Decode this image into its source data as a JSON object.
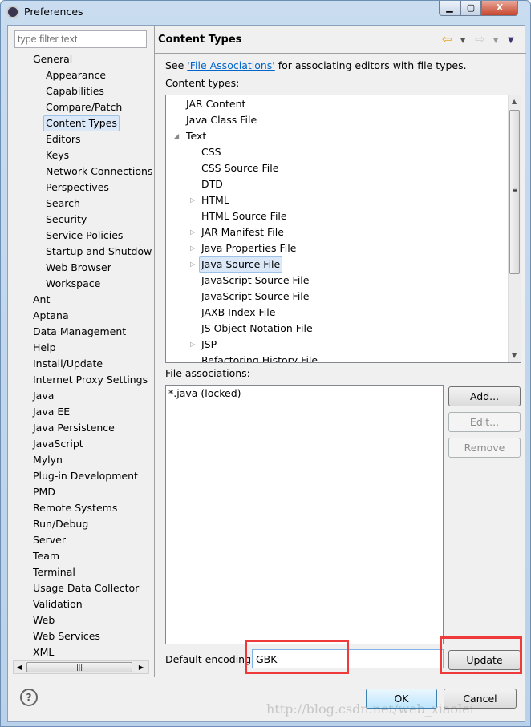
{
  "window": {
    "title": "Preferences",
    "minimize": "▁",
    "maximize": "▢",
    "close": "X"
  },
  "sidebar": {
    "filter_placeholder": "type filter text",
    "items": [
      {
        "label": "General",
        "level": 0
      },
      {
        "label": "Appearance",
        "level": 1
      },
      {
        "label": "Capabilities",
        "level": 1
      },
      {
        "label": "Compare/Patch",
        "level": 1
      },
      {
        "label": "Content Types",
        "level": 1,
        "selected": true
      },
      {
        "label": "Editors",
        "level": 1
      },
      {
        "label": "Keys",
        "level": 1
      },
      {
        "label": "Network Connections",
        "level": 1
      },
      {
        "label": "Perspectives",
        "level": 1
      },
      {
        "label": "Search",
        "level": 1
      },
      {
        "label": "Security",
        "level": 1
      },
      {
        "label": "Service Policies",
        "level": 1
      },
      {
        "label": "Startup and Shutdow",
        "level": 1
      },
      {
        "label": "Web Browser",
        "level": 1
      },
      {
        "label": "Workspace",
        "level": 1
      },
      {
        "label": "Ant",
        "level": 0
      },
      {
        "label": "Aptana",
        "level": 0
      },
      {
        "label": "Data Management",
        "level": 0
      },
      {
        "label": "Help",
        "level": 0
      },
      {
        "label": "Install/Update",
        "level": 0
      },
      {
        "label": "Internet Proxy Settings",
        "level": 0
      },
      {
        "label": "Java",
        "level": 0
      },
      {
        "label": "Java EE",
        "level": 0
      },
      {
        "label": "Java Persistence",
        "level": 0
      },
      {
        "label": "JavaScript",
        "level": 0
      },
      {
        "label": "Mylyn",
        "level": 0
      },
      {
        "label": "Plug-in Development",
        "level": 0
      },
      {
        "label": "PMD",
        "level": 0
      },
      {
        "label": "Remote Systems",
        "level": 0
      },
      {
        "label": "Run/Debug",
        "level": 0
      },
      {
        "label": "Server",
        "level": 0
      },
      {
        "label": "Team",
        "level": 0
      },
      {
        "label": "Terminal",
        "level": 0
      },
      {
        "label": "Usage Data Collector",
        "level": 0
      },
      {
        "label": "Validation",
        "level": 0
      },
      {
        "label": "Web",
        "level": 0
      },
      {
        "label": "Web Services",
        "level": 0
      },
      {
        "label": "XML",
        "level": 0
      }
    ]
  },
  "main": {
    "title": "Content Types",
    "see_prefix": "See ",
    "see_link": "'File Associations'",
    "see_suffix": " for associating editors with file types.",
    "content_types_label": "Content types:",
    "content_types": [
      {
        "label": "JAR Content",
        "level": 0
      },
      {
        "label": "Java Class File",
        "level": 0
      },
      {
        "label": "Text",
        "level": 0,
        "expanded": true
      },
      {
        "label": "CSS",
        "level": 1
      },
      {
        "label": "CSS Source File",
        "level": 1
      },
      {
        "label": "DTD",
        "level": 1
      },
      {
        "label": "HTML",
        "level": 1,
        "collapsed": true
      },
      {
        "label": "HTML Source File",
        "level": 1
      },
      {
        "label": "JAR Manifest File",
        "level": 1,
        "collapsed": true
      },
      {
        "label": "Java Properties File",
        "level": 1,
        "collapsed": true
      },
      {
        "label": "Java Source File",
        "level": 1,
        "collapsed": true,
        "selected": true
      },
      {
        "label": "JavaScript Source File",
        "level": 1
      },
      {
        "label": "JavaScript Source File",
        "level": 1
      },
      {
        "label": "JAXB Index File",
        "level": 1
      },
      {
        "label": "JS Object Notation File",
        "level": 1
      },
      {
        "label": "JSP",
        "level": 1,
        "collapsed": true
      },
      {
        "label": "Refactoring History File",
        "level": 1
      }
    ],
    "file_assoc_label": "File associations:",
    "file_assocs": [
      "*.java (locked)"
    ],
    "add": "Add...",
    "edit": "Edit...",
    "remove": "Remove",
    "encoding_label": "Default encoding:",
    "encoding_value": "GBK",
    "update": "Update"
  },
  "footer": {
    "help": "?",
    "ok": "OK",
    "cancel": "Cancel"
  },
  "watermark": "http://blog.csdn.net/web_xiaolei",
  "colors": {
    "highlight": "#ee3a3a",
    "link": "#0066cc"
  }
}
